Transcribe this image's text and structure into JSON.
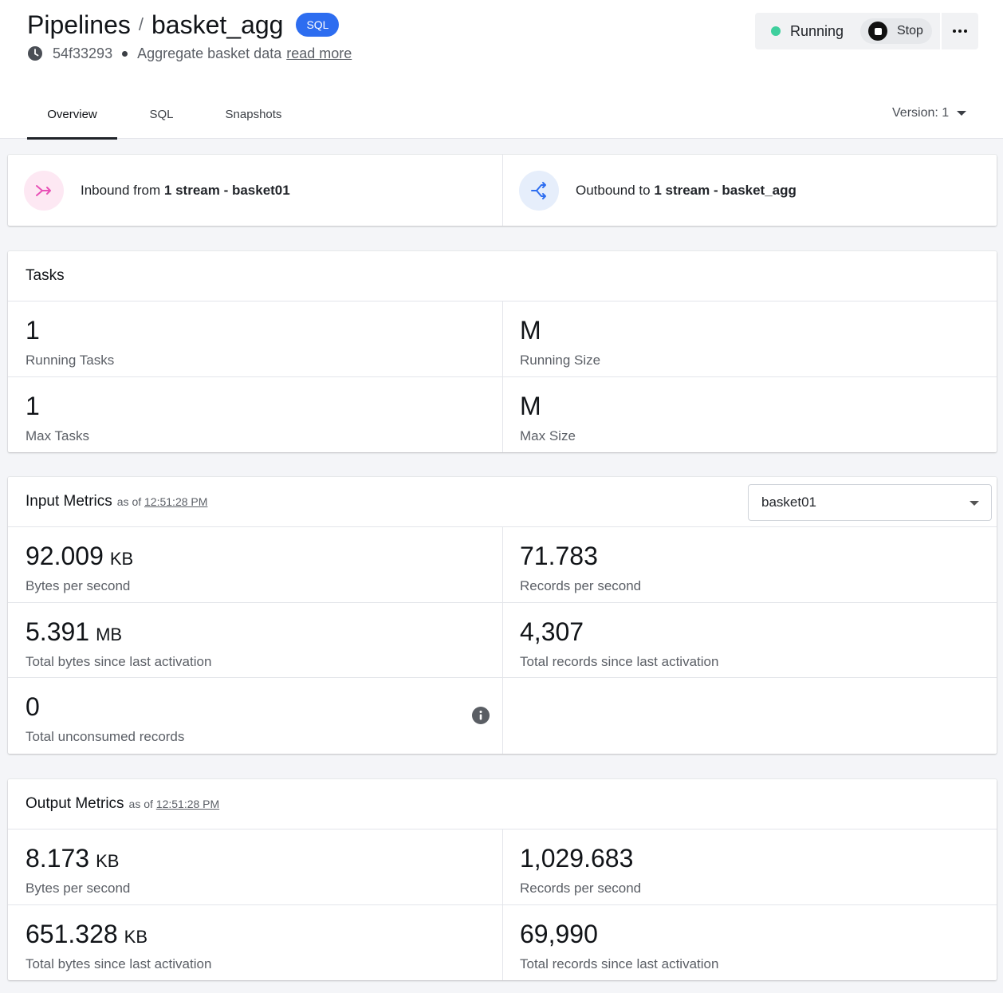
{
  "header": {
    "breadcrumb_root": "Pipelines",
    "breadcrumb_sep": "/",
    "pipeline_name": "basket_agg",
    "lang_badge": "SQL",
    "commit": "54f33293",
    "description": "Aggregate basket data",
    "read_more": "read more"
  },
  "status": {
    "state": "Running",
    "stop_label": "Stop",
    "state_color": "#3ecf9d"
  },
  "tabs": [
    {
      "label": "Overview",
      "active": true
    },
    {
      "label": "SQL",
      "active": false
    },
    {
      "label": "Snapshots",
      "active": false
    }
  ],
  "version": {
    "label": "Version: 1"
  },
  "streams": {
    "inbound_prefix": "Inbound from ",
    "inbound_count": "1 stream - basket01",
    "outbound_prefix": "Outbound to ",
    "outbound_count": "1 stream - basket_agg"
  },
  "tasks": {
    "title": "Tasks",
    "cells": [
      {
        "value": "1",
        "label": "Running Tasks"
      },
      {
        "value": "M",
        "label": "Running Size"
      },
      {
        "value": "1",
        "label": "Max Tasks"
      },
      {
        "value": "M",
        "label": "Max Size"
      }
    ]
  },
  "input_metrics": {
    "title": "Input Metrics",
    "as_of_prefix": "as of",
    "as_of_time": "12:51:28 PM",
    "selected_stream": "basket01",
    "cells": [
      {
        "value": "92.009",
        "unit": "KB",
        "label": "Bytes per second"
      },
      {
        "value": "71.783",
        "unit": "",
        "label": "Records per second"
      },
      {
        "value": "5.391",
        "unit": "MB",
        "label": "Total bytes since last activation"
      },
      {
        "value": "4,307",
        "unit": "",
        "label": "Total records since last activation"
      },
      {
        "value": "0",
        "unit": "",
        "label": "Total unconsumed records"
      }
    ]
  },
  "output_metrics": {
    "title": "Output Metrics",
    "as_of_prefix": "as of",
    "as_of_time": "12:51:28 PM",
    "cells": [
      {
        "value": "8.173",
        "unit": "KB",
        "label": "Bytes per second"
      },
      {
        "value": "1,029.683",
        "unit": "",
        "label": "Records per second"
      },
      {
        "value": "651.328",
        "unit": "KB",
        "label": "Total bytes since last activation"
      },
      {
        "value": "69,990",
        "unit": "",
        "label": "Total records since last activation"
      }
    ]
  },
  "colors": {
    "accent": "#2d6df0",
    "inbound_icon": "#e84fb6",
    "outbound_icon": "#2d6df0"
  },
  "icons": [
    "clock-icon",
    "stop-icon",
    "more-icon",
    "caret-down-icon",
    "inbound-merge-icon",
    "outbound-split-icon",
    "info-icon"
  ]
}
